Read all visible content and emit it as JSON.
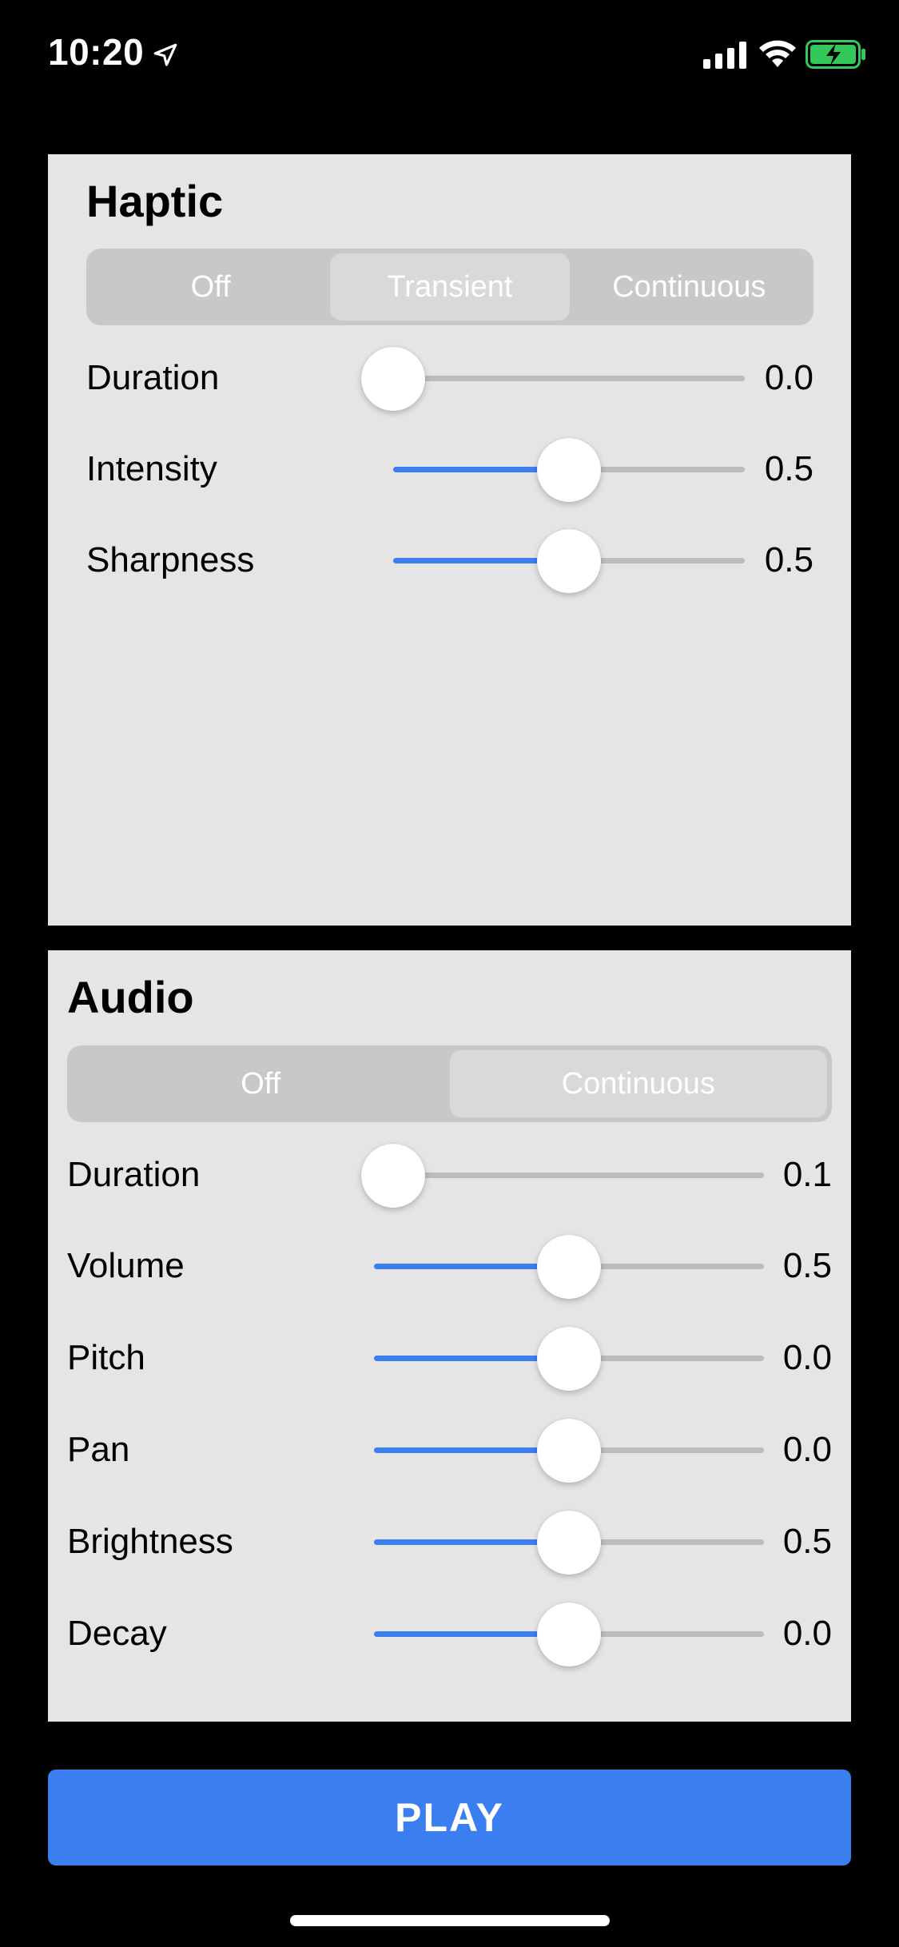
{
  "status_bar": {
    "time": "10:20",
    "icons": [
      "location-arrow-icon",
      "cellular-signal-icon",
      "wifi-icon",
      "battery-charging-icon"
    ],
    "battery_color": "#34c759"
  },
  "haptic": {
    "title": "Haptic",
    "segments": [
      {
        "label": "Off",
        "selected": false
      },
      {
        "label": "Transient",
        "selected": true
      },
      {
        "label": "Continuous",
        "selected": false
      }
    ],
    "sliders": [
      {
        "label": "Duration",
        "value": "0.0",
        "fraction": 0.0
      },
      {
        "label": "Intensity",
        "value": "0.5",
        "fraction": 0.5
      },
      {
        "label": "Sharpness",
        "value": "0.5",
        "fraction": 0.5
      }
    ]
  },
  "audio": {
    "title": "Audio",
    "segments": [
      {
        "label": "Off",
        "selected": false
      },
      {
        "label": "Continuous",
        "selected": true
      }
    ],
    "sliders": [
      {
        "label": "Duration",
        "value": "0.1",
        "fraction": 0.05
      },
      {
        "label": "Volume",
        "value": "0.5",
        "fraction": 0.5
      },
      {
        "label": "Pitch",
        "value": "0.0",
        "fraction": 0.5
      },
      {
        "label": "Pan",
        "value": "0.0",
        "fraction": 0.5
      },
      {
        "label": "Brightness",
        "value": "0.5",
        "fraction": 0.5
      },
      {
        "label": "Decay",
        "value": "0.0",
        "fraction": 0.5
      }
    ]
  },
  "play_button": {
    "label": "PLAY"
  },
  "colors": {
    "accent": "#3b7ef0",
    "panel_background": "#e5e5e5",
    "track": "#bcbcbc"
  }
}
